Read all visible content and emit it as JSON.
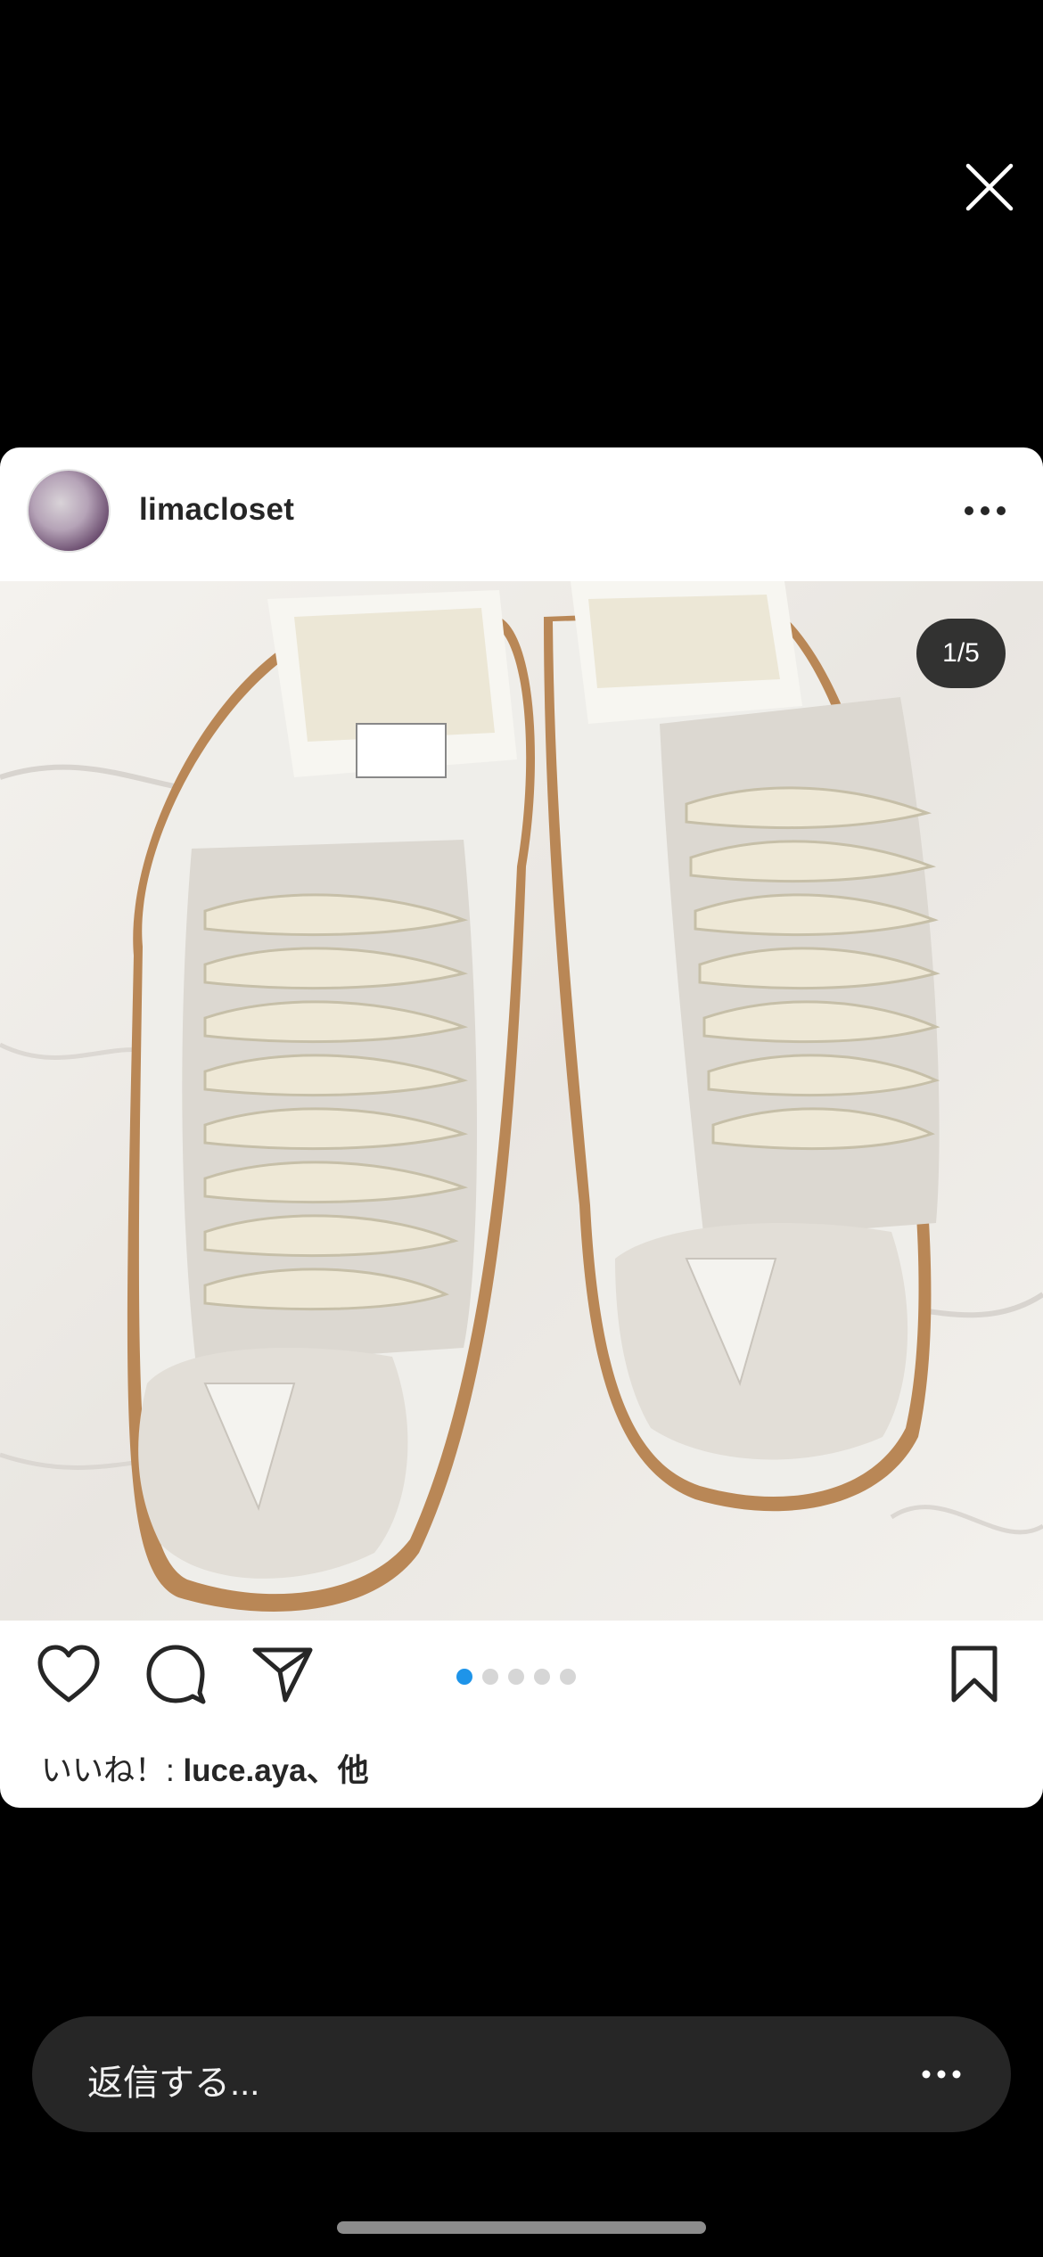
{
  "header": {
    "username": "limacloset"
  },
  "post": {
    "image_counter": "1/5",
    "carousel_dots": 5,
    "carousel_active_index": 0,
    "likes_prefix": "いいね！: ",
    "likes_user": "luce.aya",
    "likes_suffix": "、他"
  },
  "reply": {
    "placeholder": "返信する..."
  },
  "icons": {
    "close": "close-icon",
    "more": "more-horizontal-icon",
    "like": "heart-icon",
    "comment": "comment-icon",
    "share": "send-icon",
    "save": "bookmark-icon"
  },
  "colors": {
    "accent": "#1e94e9",
    "background": "#000000",
    "card": "#ffffff",
    "reply_bar": "#262626"
  }
}
